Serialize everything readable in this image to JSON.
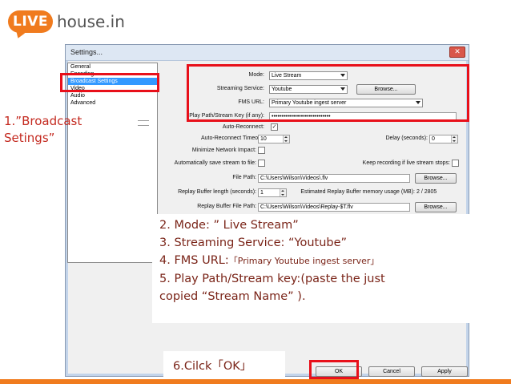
{
  "logo": {
    "badge": "LIVE",
    "text": "house.in"
  },
  "dialog": {
    "title": "Settings...",
    "close_glyph": "✕",
    "sidebar": [
      "General",
      "Encoding",
      "Broadcast Settings",
      "Video",
      "Audio",
      "Advanced"
    ],
    "selected_index": 2
  },
  "form": {
    "mode_label": "Mode:",
    "mode_value": "Live Stream",
    "service_label": "Streaming Service:",
    "service_value": "Youtube",
    "fms_label": "FMS URL:",
    "fms_value": "Primary Youtube ingest server",
    "key_label": "Play Path/Stream Key (if any):",
    "key_value": "••••••••••••••••••••••••••••••",
    "autoreconnect_label": "Auto-Reconnect:",
    "autoreconnect_timeout_label": "Auto-Reconnect Timeout:",
    "autoreconnect_timeout_value": "10",
    "delay_label": "Delay (seconds):",
    "delay_value": "0",
    "minimize_label": "Minimize Network Impact:",
    "autosave_label": "Automatically save stream to file:",
    "keep_recording_label": "Keep recording if live stream stops:",
    "filepath_label": "File Path:",
    "filepath_value": "C:\\Users\\Wilson\\Videos\\.flv",
    "replay_len_label": "Replay Buffer length (seconds):",
    "replay_len_value": "1",
    "estimated_label": "Estimated Replay Buffer memory usage (MB):",
    "estimated_value": "2 / 2805",
    "replay_path_label": "Replay Buffer File Path:",
    "replay_path_value": "C:\\Users\\Wilson\\Videos\\Replay-$T.flv",
    "browse_label": "Browse...",
    "ok_label": "OK",
    "cancel_label": "Cancel",
    "apply_label": "Apply",
    "check_mark": "✓"
  },
  "annotations": {
    "step1_line1": "1.”Broadcast",
    "step1_line2": "Setings”",
    "step2": "2. Mode: ” Live Stream”",
    "step3": "3. Streaming Service:  “Youtube”",
    "step4_prefix": "4. FMS URL:",
    "step4_value": "「Primary Youtube ingest server」",
    "step5_line1": "5. Play Path/Stream key:(paste the just",
    "step5_line2": "copied  “Stream Name” ).",
    "step6": "6.Cilck「OK」"
  },
  "colors": {
    "highlight": "#e8101a",
    "brand": "#f07b1e",
    "note_text": "#7a2418"
  }
}
